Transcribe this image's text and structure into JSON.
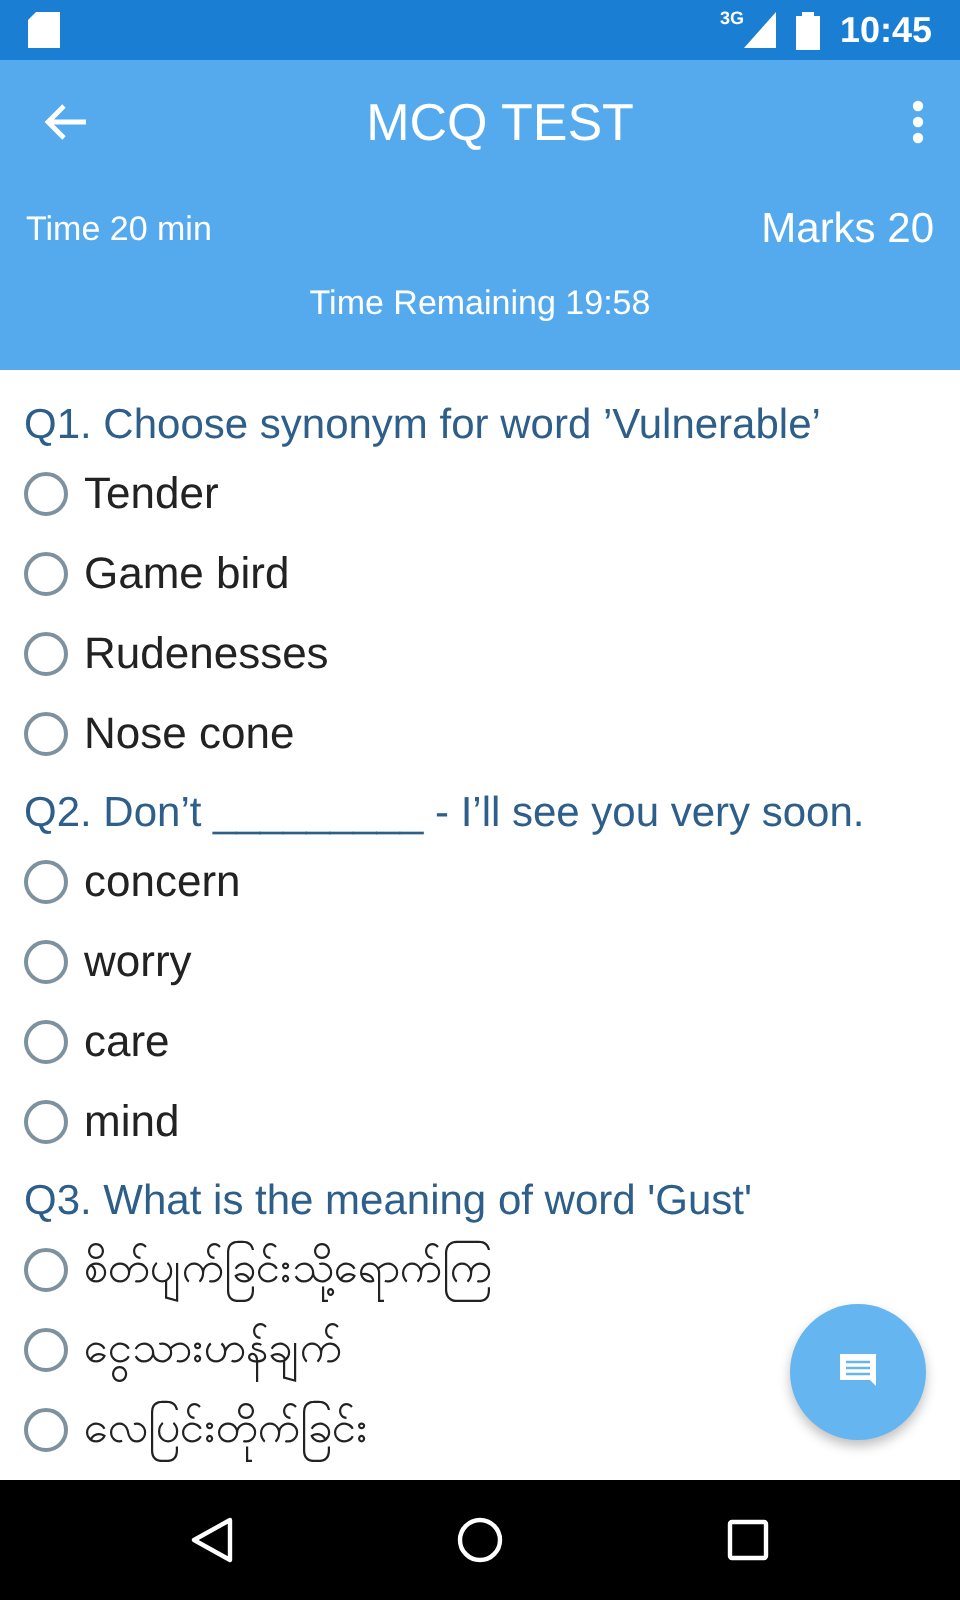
{
  "status_bar": {
    "network": "3G",
    "time": "10:45"
  },
  "app_bar": {
    "title": "MCQ TEST"
  },
  "test_info": {
    "duration": "Time 20 min",
    "marks": "Marks 20",
    "remaining": "Time Remaining 19:58"
  },
  "questions": [
    {
      "text": "Q1. Choose synonym for word ’Vulnerable’",
      "options": [
        {
          "label": "Tender",
          "selected": false
        },
        {
          "label": "Game bird",
          "selected": false
        },
        {
          "label": "Rudenesses",
          "selected": false
        },
        {
          "label": "Nose cone",
          "selected": false
        }
      ]
    },
    {
      "text": "Q2. Don’t _________ - I’ll see you very soon.",
      "options": [
        {
          "label": "concern",
          "selected": false
        },
        {
          "label": "worry",
          "selected": false
        },
        {
          "label": "care",
          "selected": false
        },
        {
          "label": "mind",
          "selected": false
        }
      ]
    },
    {
      "text": "Q3. What is the meaning of word 'Gust'",
      "options": [
        {
          "label": "စိတ်ပျက်ခြင်းသို့ရောက်ကြ",
          "selected": false
        },
        {
          "label": "ငွေသားဟန်ချက်",
          "selected": false
        },
        {
          "label": "လေပြင်းတိုက်ခြင်း",
          "selected": false
        }
      ]
    }
  ]
}
